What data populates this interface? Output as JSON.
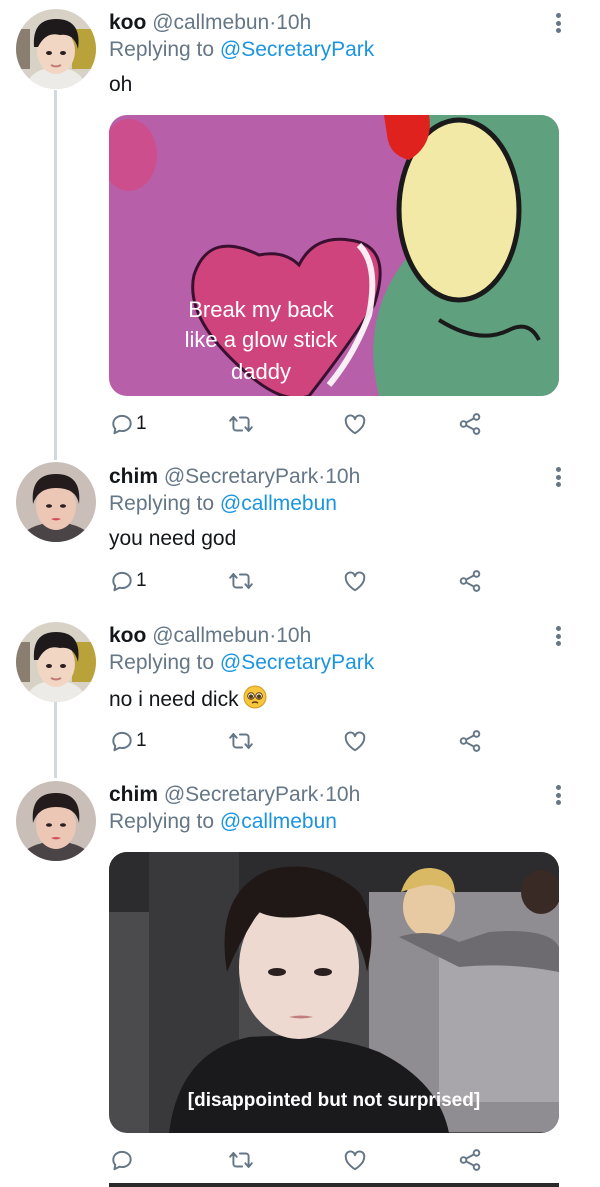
{
  "tweets": [
    {
      "name": "koo",
      "handle": "@callmebun",
      "dot": "·",
      "time": "10h",
      "replying_prefix": "Replying to ",
      "replying_to": "@SecretaryPark",
      "text": "oh",
      "media_caption": [
        "Break my back",
        "like a glow stick",
        "daddy"
      ],
      "reply_count": "1"
    },
    {
      "name": "chim",
      "handle": "@SecretaryPark",
      "dot": "·",
      "time": "10h",
      "replying_prefix": "Replying to ",
      "replying_to": "@callmebun",
      "text": "you need god",
      "reply_count": "1"
    },
    {
      "name": "koo",
      "handle": "@callmebun",
      "dot": "·",
      "time": "10h",
      "replying_prefix": "Replying to ",
      "replying_to": "@SecretaryPark",
      "text": "no i need dick",
      "reply_count": "1"
    },
    {
      "name": "chim",
      "handle": "@SecretaryPark",
      "dot": "·",
      "time": "10h",
      "replying_prefix": "Replying to ",
      "replying_to": "@callmebun",
      "media_caption": "[disappointed but not surprised]",
      "reply_count": ""
    }
  ],
  "icons": {
    "reply": "reply-icon",
    "retweet": "retweet-icon",
    "like": "heart-icon",
    "share": "share-icon",
    "more": "more-icon",
    "emoji": "pleading-face-emoji"
  },
  "colors": {
    "link": "#1b95e0",
    "secondary_text": "#657786",
    "thread_line": "#cfd9de"
  }
}
